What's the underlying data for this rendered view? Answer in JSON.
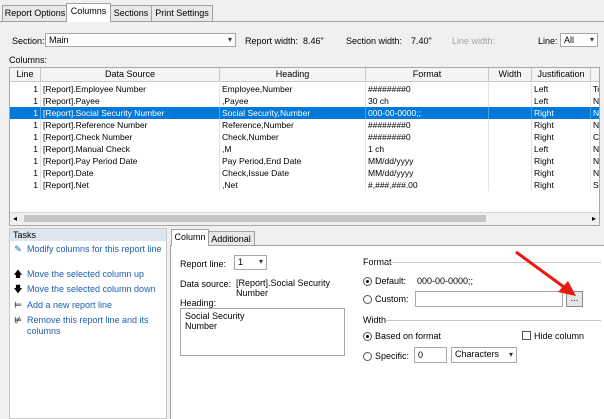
{
  "tabs": [
    "Report Options",
    "Columns",
    "Sections",
    "Print Settings"
  ],
  "section_row": {
    "section_label": "Section:",
    "section_value": "Main",
    "report_width_label": "Report width:",
    "report_width_value": "8.46\"",
    "section_width_label": "Section width:",
    "section_width_value": "7.40\"",
    "line_width_label": "Line width:",
    "line_label": "Line:",
    "line_value": "All"
  },
  "columns_label": "Columns:",
  "grid": {
    "headers": [
      "Line",
      "Data Source",
      "Heading",
      "Format",
      "Width",
      "Justification",
      ""
    ],
    "rows": [
      [
        "1",
        "[Report].Employee Number",
        "Employee,Number",
        "########0",
        "",
        "Left",
        "Tot"
      ],
      [
        "1",
        "[Report].Payee",
        ",Payee",
        "30 ch",
        "",
        "Left",
        "Nor"
      ],
      [
        "1",
        "[Report].Social Security Number",
        "Social Security,Number",
        "000-00-0000;;",
        "",
        "Right",
        "Nor"
      ],
      [
        "1",
        "[Report].Reference Number",
        "Reference,Number",
        "########0",
        "",
        "Right",
        "Nor"
      ],
      [
        "1",
        "[Report].Check Number",
        "Check,Number",
        "########0",
        "",
        "Right",
        "Cou"
      ],
      [
        "1",
        "[Report].Manual Check",
        ",M",
        "1 ch",
        "",
        "Left",
        "Nor"
      ],
      [
        "1",
        "[Report].Pay Period Date",
        "Pay Period,End Date",
        "MM/dd/yyyy",
        "",
        "Right",
        "Nor"
      ],
      [
        "1",
        "[Report].Date",
        "Check,Issue Date",
        "MM/dd/yyyy",
        "",
        "Right",
        "Nor"
      ],
      [
        "1",
        "[Report].Net",
        ",Net",
        "#,###,###.00",
        "",
        "Right",
        "Sur"
      ]
    ],
    "selected_row": 2
  },
  "tasks": {
    "title": "Tasks",
    "items": [
      {
        "label": "Modify columns for this report line",
        "icon": "edit-icon"
      },
      {
        "label": "Move the selected column up",
        "icon": "arrow-up-icon"
      },
      {
        "label": "Move the selected column down",
        "icon": "arrow-down-icon"
      },
      {
        "label": "Add a new report line",
        "icon": "add-line-icon"
      },
      {
        "label": "Remove this report line and its columns",
        "icon": "remove-line-icon"
      }
    ]
  },
  "panel_tabs": [
    "Column",
    "Additional"
  ],
  "column_panel": {
    "report_line_label": "Report line:",
    "report_line_value": "1",
    "data_source_label": "Data source:",
    "data_source_value": "[Report].Social Security Number",
    "heading_label": "Heading:",
    "heading_value": "Social Security\nNumber",
    "format_group_label": "Format",
    "default_label": "Default:",
    "default_value": "000-00-0000;;",
    "custom_label": "Custom:",
    "custom_value": "",
    "browse_label": "...",
    "width_group_label": "Width",
    "based_on_format_label": "Based on format",
    "hide_column_label": "Hide column",
    "specific_label": "Specific:",
    "specific_value": "0",
    "units_value": "Characters"
  },
  "colors": {
    "selection": "#0078d7",
    "link": "#1a5fb4",
    "annotation_arrow": "#e8190f"
  }
}
